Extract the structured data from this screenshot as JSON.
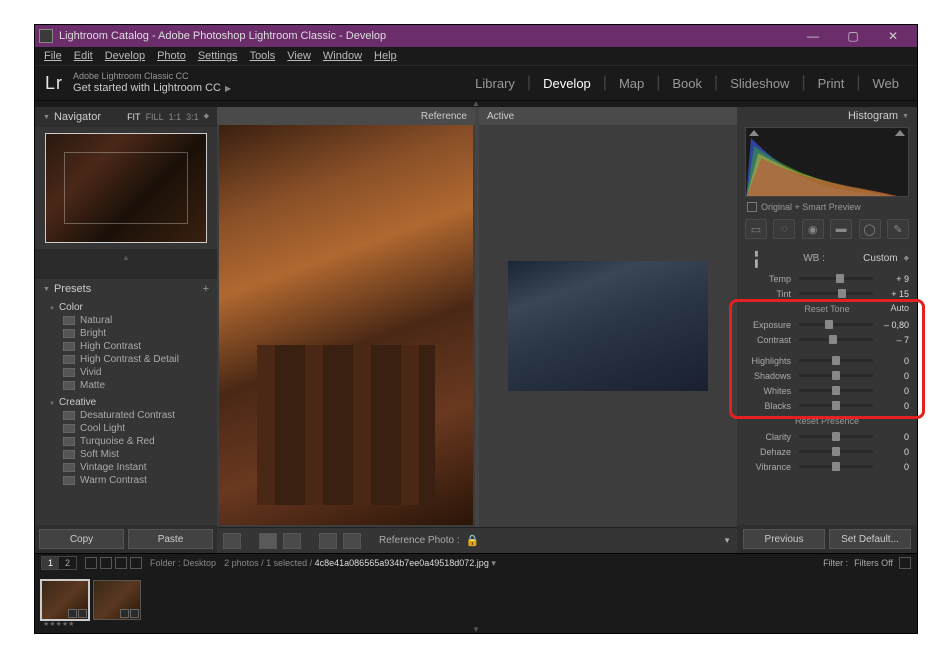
{
  "window": {
    "title": "Lightroom Catalog - Adobe Photoshop Lightroom Classic - Develop"
  },
  "menu": {
    "file": "File",
    "edit": "Edit",
    "develop": "Develop",
    "photo": "Photo",
    "settings": "Settings",
    "tools": "Tools",
    "view": "View",
    "window": "Window",
    "help": "Help"
  },
  "brand": {
    "lr": "Lr",
    "sub1": "Adobe Lightroom Classic CC",
    "sub2": "Get started with Lightroom CC"
  },
  "modules": {
    "library": "Library",
    "develop": "Develop",
    "map": "Map",
    "book": "Book",
    "slideshow": "Slideshow",
    "print": "Print",
    "web": "Web"
  },
  "navigator": {
    "title": "Navigator",
    "modes": {
      "fit": "FIT",
      "fill": "FILL",
      "one": "1:1",
      "three": "3:1"
    }
  },
  "presets": {
    "title": "Presets",
    "groups": [
      {
        "name": "Color",
        "items": [
          "Natural",
          "Bright",
          "High Contrast",
          "High Contrast & Detail",
          "Vivid",
          "Matte"
        ]
      },
      {
        "name": "Creative",
        "items": [
          "Desaturated Contrast",
          "Cool Light",
          "Turquoise & Red",
          "Soft Mist",
          "Vintage Instant",
          "Warm Contrast"
        ]
      }
    ]
  },
  "leftButtons": {
    "copy": "Copy",
    "paste": "Paste"
  },
  "center": {
    "reference": "Reference",
    "active": "Active",
    "toolbar_label": "Reference Photo :"
  },
  "right": {
    "histogram": "Histogram",
    "preview": "Original + Smart Preview",
    "wb": {
      "label": "WB :",
      "value": "Custom"
    },
    "temp": {
      "label": "Temp",
      "value": "+ 9"
    },
    "tint": {
      "label": "Tint",
      "value": "+ 15"
    },
    "tone": {
      "label": "Reset Tone",
      "auto": "Auto"
    },
    "exposure": {
      "label": "Exposure",
      "value": "– 0,80"
    },
    "contrast": {
      "label": "Contrast",
      "value": "– 7"
    },
    "highlights": {
      "label": "Highlights",
      "value": "0"
    },
    "shadows": {
      "label": "Shadows",
      "value": "0"
    },
    "whites": {
      "label": "Whites",
      "value": "0"
    },
    "blacks": {
      "label": "Blacks",
      "value": "0"
    },
    "presence": {
      "label": "Reset Presence"
    },
    "clarity": {
      "label": "Clarity",
      "value": "0"
    },
    "dehaze": {
      "label": "Dehaze",
      "value": "0"
    },
    "vibrance": {
      "label": "Vibrance",
      "value": "0"
    },
    "previous": "Previous",
    "setdefault": "Set Default..."
  },
  "strip": {
    "folder_label": "Folder : Desktop",
    "count": "2 photos / 1 selected /",
    "filename": "4c8e41a086565a934b7ee0a49518d072.jpg",
    "filter": "Filter :",
    "filters_off": "Filters Off",
    "rating": "★★★★★"
  }
}
